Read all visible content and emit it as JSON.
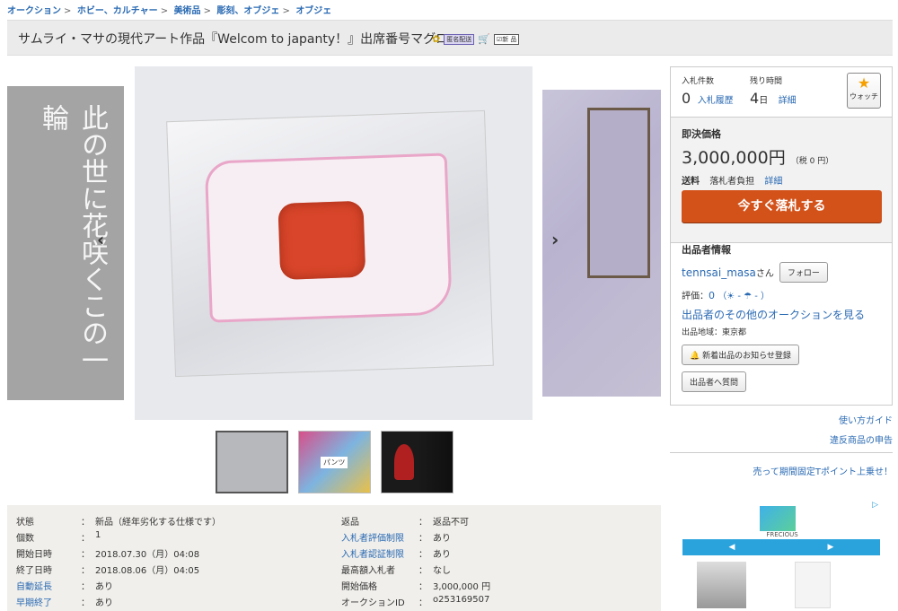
{
  "breadcrumb": [
    "オークション",
    "ホビー、カルチャー",
    "美術品",
    "彫刻、オブジェ",
    "オブジェ"
  ],
  "title": "サムライ・マサの現代アート作品『Welcom to japanty！』出席番号マグロ",
  "badges": [
    "匿名配送",
    "新 品"
  ],
  "summary": {
    "bid_count_label": "入札件数",
    "bid_count": "0",
    "history_link": "入札履歴",
    "remain_label": "残り時間",
    "remain_value": "4",
    "remain_unit": "日",
    "detail_link": "詳細",
    "watch_label": "ウォッチ"
  },
  "buyout": {
    "heading": "即決価格",
    "price": "3,000,000円",
    "tax": "（税 0 円）",
    "ship_label": "送料",
    "ship_value": "落札者負担",
    "ship_detail": "詳細",
    "button": "今すぐ落札する"
  },
  "seller": {
    "heading": "出品者情報",
    "name": "tennsai_masa",
    "suffix": "さん",
    "follow": "フォロー",
    "rating_label": "評価：",
    "rating_value": "0",
    "rating_sym": "（☀ - ☂ - ）",
    "other_link": "出品者のその他のオークションを見る",
    "region": "出品地域：東京都",
    "notify": "新着出品のお知らせ登録",
    "question": "出品者へ質問"
  },
  "side_links": [
    "使い方ガイド",
    "違反商品の申告",
    "売って期間固定Tポイント上乗せ！"
  ],
  "ad": {
    "brand": "FRECIOUS"
  },
  "image_kanji": "此の世に花咲くこの一輪",
  "thumb_label": "パンツ",
  "details_left": [
    {
      "k": "状態",
      "v": "新品（経年劣化する仕様です）",
      "link": false
    },
    {
      "k": "個数",
      "v": "1",
      "link": false
    },
    {
      "k": "開始日時",
      "v": "2018.07.30（月）04:08",
      "link": false
    },
    {
      "k": "終了日時",
      "v": "2018.08.06（月）04:05",
      "link": false
    },
    {
      "k": "自動延長",
      "v": "あり",
      "link": true
    },
    {
      "k": "早期終了",
      "v": "あり",
      "link": true
    }
  ],
  "details_right": [
    {
      "k": "返品",
      "v": "返品不可",
      "link": false
    },
    {
      "k": "入札者評価制限",
      "v": "あり",
      "link": true
    },
    {
      "k": "入札者認証制限",
      "v": "あり",
      "link": true
    },
    {
      "k": "最高額入札者",
      "v": "なし",
      "link": false
    },
    {
      "k": "開始価格",
      "v": "3,000,000 円",
      "link": false
    },
    {
      "k": "オークションID",
      "v": "o253169507",
      "link": false
    }
  ]
}
